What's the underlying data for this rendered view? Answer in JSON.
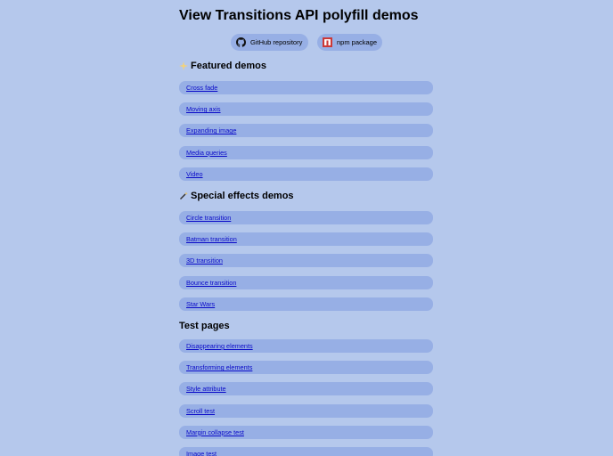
{
  "page": {
    "title": "View Transitions API polyfill demos"
  },
  "links": {
    "github": {
      "label": "GitHub repository",
      "icon": "github-icon"
    },
    "npm": {
      "label": "npm package",
      "icon": "npm-icon"
    }
  },
  "sections": {
    "featured": {
      "title": "Featured demos",
      "icon": "sparkle-icon",
      "items": [
        "Cross fade",
        "Moving axis",
        "Expanding image",
        "Media queries",
        "Video"
      ]
    },
    "special": {
      "title": "Special effects demos",
      "icon": "magic-wand-icon",
      "items": [
        "Circle transition",
        "Batman transition",
        "3D transition",
        "Bounce transition",
        "Star Wars"
      ]
    },
    "test": {
      "title": "Test pages",
      "items": [
        "Disappearing elements",
        "Transforming elements",
        "Style attribute",
        "Scroll test",
        "Margin collapse test",
        "Image test"
      ]
    }
  },
  "colors": {
    "background": "#b5c8ec",
    "pill": "#97afe5",
    "link": "#0a0ac8"
  }
}
